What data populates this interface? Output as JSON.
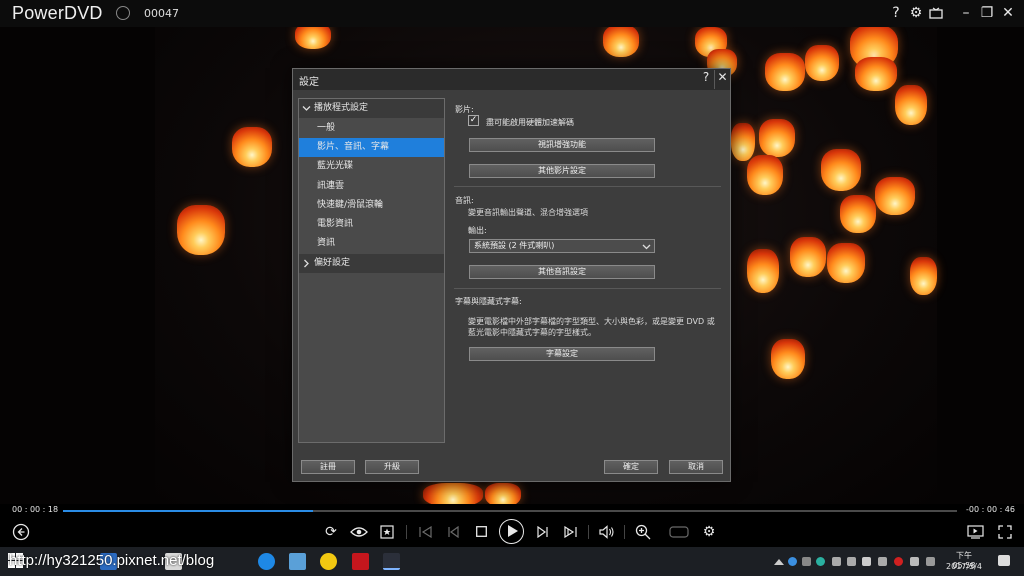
{
  "player": {
    "title": "PowerDVD",
    "track": "00047",
    "title_icons": [
      "bell-icon"
    ],
    "top_right_icons": [
      "help-icon",
      "gear-icon",
      "tv-mode-icon",
      "minimize-icon",
      "restore-icon",
      "close-icon"
    ],
    "time_elapsed": "00 : 00 : 18",
    "time_remaining": "-00 : 00 : 46",
    "progress_fraction": 0.28,
    "accent_color": "#2a8ce6"
  },
  "dialog": {
    "title": "設定",
    "help": "?",
    "close": "✕",
    "tree": {
      "group_playback": "播放程式設定",
      "items": [
        "一般",
        "影片、音訊、字幕",
        "藍光光碟",
        "訊連雲",
        "快速鍵/滑鼠滾輪",
        "電影資訊",
        "資訊"
      ],
      "selected_index": 1,
      "group_preferences": "偏好設定"
    },
    "video": {
      "label": "影片:",
      "hw_accel_checked": true,
      "hw_accel_label": "盡可能啟用硬體加速解碼",
      "enhance_button": "視訊增強功能",
      "other_button": "其他影片設定"
    },
    "audio": {
      "label": "音訊:",
      "desc": "變更音訊輸出聲道、混合增強選項",
      "output_label": "輸出:",
      "output_value": "系統預設 (2 件式喇叭)",
      "other_button": "其他音訊設定"
    },
    "subtitle": {
      "label": "字幕與隱藏式字幕:",
      "desc_line1": "變更電影檔中外部字幕檔的字型類型、大小與色彩，或是變更 DVD 或",
      "desc_line2": "藍光電影中隱藏式字幕的字型樣式。",
      "button": "字幕設定"
    },
    "footer": {
      "register": "註冊",
      "upgrade": "升級",
      "ok": "確定",
      "cancel": "取消"
    }
  },
  "controls": {
    "icons": [
      "back-icon",
      "repeat-icon",
      "view-icon",
      "bookmark-icon",
      "prev-chapter-icon",
      "prev-icon",
      "stop-icon",
      "play-icon",
      "next-icon",
      "next-chapter-icon",
      "volume-icon",
      "zoom-icon",
      "vr-icon",
      "settings-icon",
      "caption-icon",
      "fullscreen-icon"
    ]
  },
  "taskbar": {
    "watermark": "http://hy321250.pixnet.net/blog",
    "time": "下午 05:58",
    "date": "2017/5/4"
  }
}
